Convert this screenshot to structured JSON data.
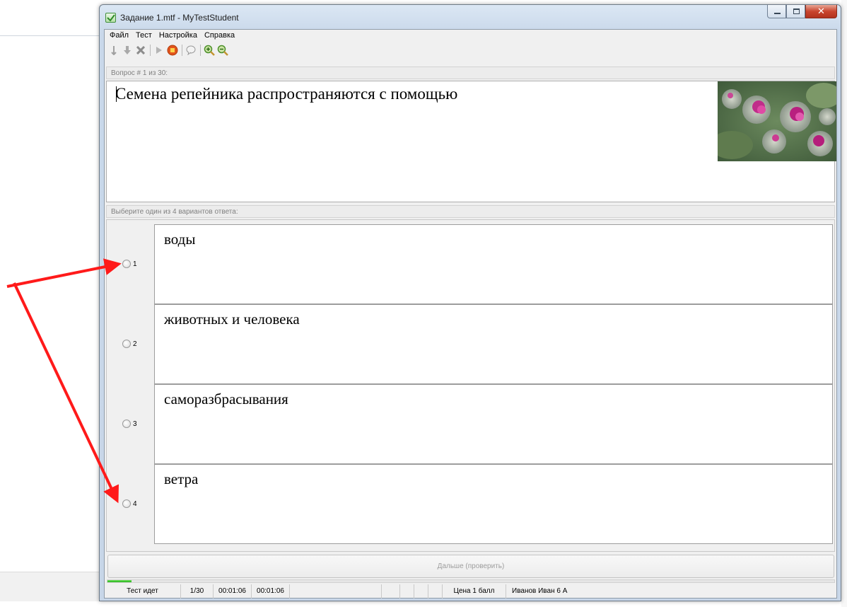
{
  "window": {
    "title": "Задание 1.mtf - MyTestStudent",
    "min_glyph": "",
    "max_glyph": "",
    "close_glyph": "✕"
  },
  "menu": [
    "Файл",
    "Тест",
    "Настройка",
    "Справка"
  ],
  "toolbar": {
    "icons": [
      "move-up-icon",
      "move-down-icon",
      "delete-icon",
      "play-icon",
      "stop-icon",
      "comment-icon",
      "zoom-in-icon",
      "zoom-out-icon"
    ]
  },
  "question": {
    "header": "Вопрос # 1 из 30:",
    "text": "Семена репейника распространяются с помощью"
  },
  "answers_header": "Выберите один из 4 вариантов ответа:",
  "answers": [
    {
      "num": "1",
      "text": "воды"
    },
    {
      "num": "2",
      "text": "животных и человека"
    },
    {
      "num": "3",
      "text": "саморазбрасывания"
    },
    {
      "num": "4",
      "text": "ветра"
    }
  ],
  "next_button": "Дальше (проверить)",
  "progress": {
    "fraction": 0.033
  },
  "status": {
    "state": "Тест идет",
    "position": "1/30",
    "time_1": "00:01:06",
    "time_2": "00:01:06",
    "price": "Цена 1 балл",
    "student": "Иванов Иван 6 А"
  },
  "colors": {
    "arrow": "#ff1a1a",
    "progress": "#2fb52a",
    "close_button": "#c9452f"
  }
}
